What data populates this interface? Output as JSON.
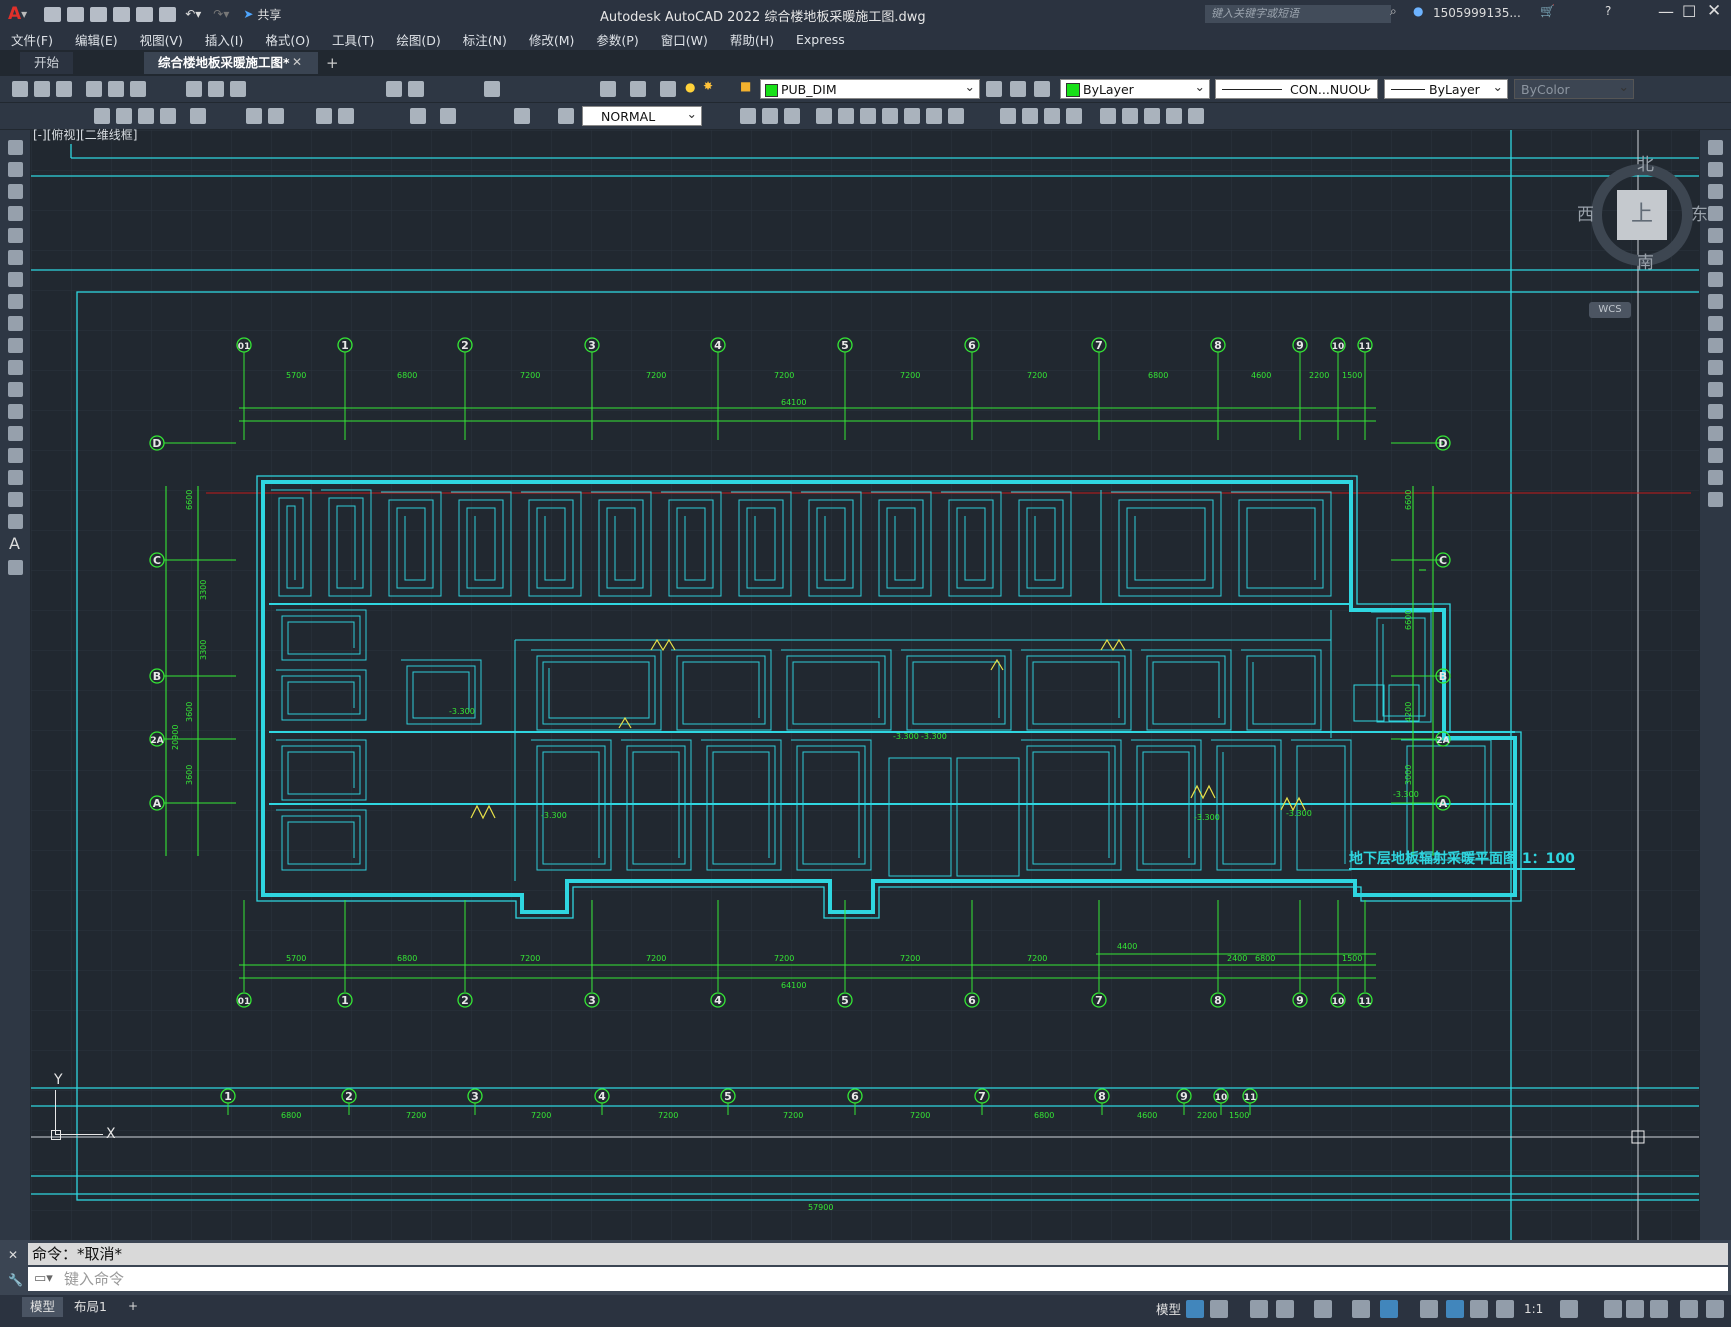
{
  "app": {
    "title": "Autodesk AutoCAD 2022    综合楼地板采暖施工图.dwg",
    "share": "共享",
    "search_placeholder": "键入关键字或短语",
    "user": "1505999135...",
    "logo": "A"
  },
  "menu": [
    "文件(F)",
    "编辑(E)",
    "视图(V)",
    "插入(I)",
    "格式(O)",
    "工具(T)",
    "绘图(D)",
    "标注(N)",
    "修改(M)",
    "参数(P)",
    "窗口(W)",
    "帮助(H)",
    "Express"
  ],
  "tabs": [
    {
      "label": "开始",
      "active": false
    },
    {
      "label": "综合楼地板采暖施工图*",
      "active": true
    }
  ],
  "toolbar": {
    "layer": "PUB_DIM",
    "color": "ByLayer",
    "linetype": "CON...NUOU",
    "lineweight": "ByLayer",
    "plotstyle": "ByColor",
    "dimstyle": "NORMAL"
  },
  "viewport": {
    "label": "[-][俯视][二维线框]"
  },
  "viewcube": {
    "north": "北",
    "south": "南",
    "east": "东",
    "west": "西",
    "top": "上",
    "wcs": "WCS"
  },
  "drawing": {
    "title": "地下层地板辐射采暖平面图 1：100",
    "top_axes": [
      "01",
      "1",
      "2",
      "3",
      "4",
      "5",
      "6",
      "7",
      "8",
      "9",
      "10",
      "11"
    ],
    "row_axes": [
      "D",
      "C",
      "B",
      "2A",
      "A"
    ],
    "spans_top": [
      "5700",
      "6800",
      "7200",
      "7200",
      "7200",
      "7200",
      "7200",
      "6800",
      "4600",
      "2200",
      "1500"
    ],
    "spans_bottom": [
      "5700",
      "6800",
      "7200",
      "7200",
      "7200",
      "7200",
      "7200",
      "6800",
      "1500"
    ],
    "bottom_extra": [
      "4400",
      "2400"
    ],
    "total_top": "64100",
    "total_bottom": "64100",
    "left_dims": [
      "6600",
      "3300",
      "3300",
      "3600",
      "3600"
    ],
    "right_dims": [
      "6600",
      "6600",
      "4200",
      "3000"
    ],
    "overall_height": "20900",
    "lower_axes": [
      "1",
      "2",
      "3",
      "4",
      "5",
      "6",
      "7",
      "8",
      "9",
      "10",
      "11"
    ],
    "lower_total": "57900",
    "lower_spans": [
      "6800",
      "7200",
      "7200",
      "7200",
      "7200",
      "7200",
      "6800",
      "4600",
      "2200",
      "1500"
    ]
  },
  "command": {
    "history": "命令：*取消*",
    "placeholder": "键入命令"
  },
  "status": {
    "model_tab": "模型",
    "layout_tab": "布局1",
    "model_btn": "模型",
    "scale": "1:1"
  },
  "colors": {
    "accent": "#2fd6e0",
    "axis": "#35e635",
    "grid": "#2c343e"
  }
}
